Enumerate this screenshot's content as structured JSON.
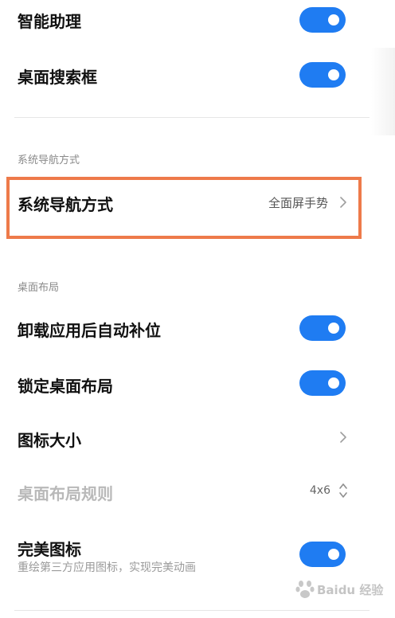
{
  "rows": {
    "smart_assistant": {
      "label": "智能助理",
      "toggle_on": true
    },
    "desktop_search": {
      "label": "桌面搜索框",
      "toggle_on": true
    },
    "nav_section": {
      "title": "系统导航方式"
    },
    "nav_mode": {
      "label": "系统导航方式",
      "value": "全面屏手势"
    },
    "layout_section": {
      "title": "桌面布局"
    },
    "auto_fill": {
      "label": "卸载应用后自动补位",
      "toggle_on": true
    },
    "lock_layout": {
      "label": "锁定桌面布局",
      "toggle_on": true
    },
    "icon_size": {
      "label": "图标大小"
    },
    "layout_rule": {
      "label": "桌面布局规则",
      "value": "4x6"
    },
    "perfect_icon": {
      "label": "完美图标",
      "sublabel": "重绘第三方应用图标，实现完美动画",
      "toggle_on": true
    }
  },
  "colors": {
    "toggle_on": "#1f7cf2",
    "highlight_border": "#ee7a4a"
  },
  "watermark": {
    "text": "Baidu 经验"
  }
}
